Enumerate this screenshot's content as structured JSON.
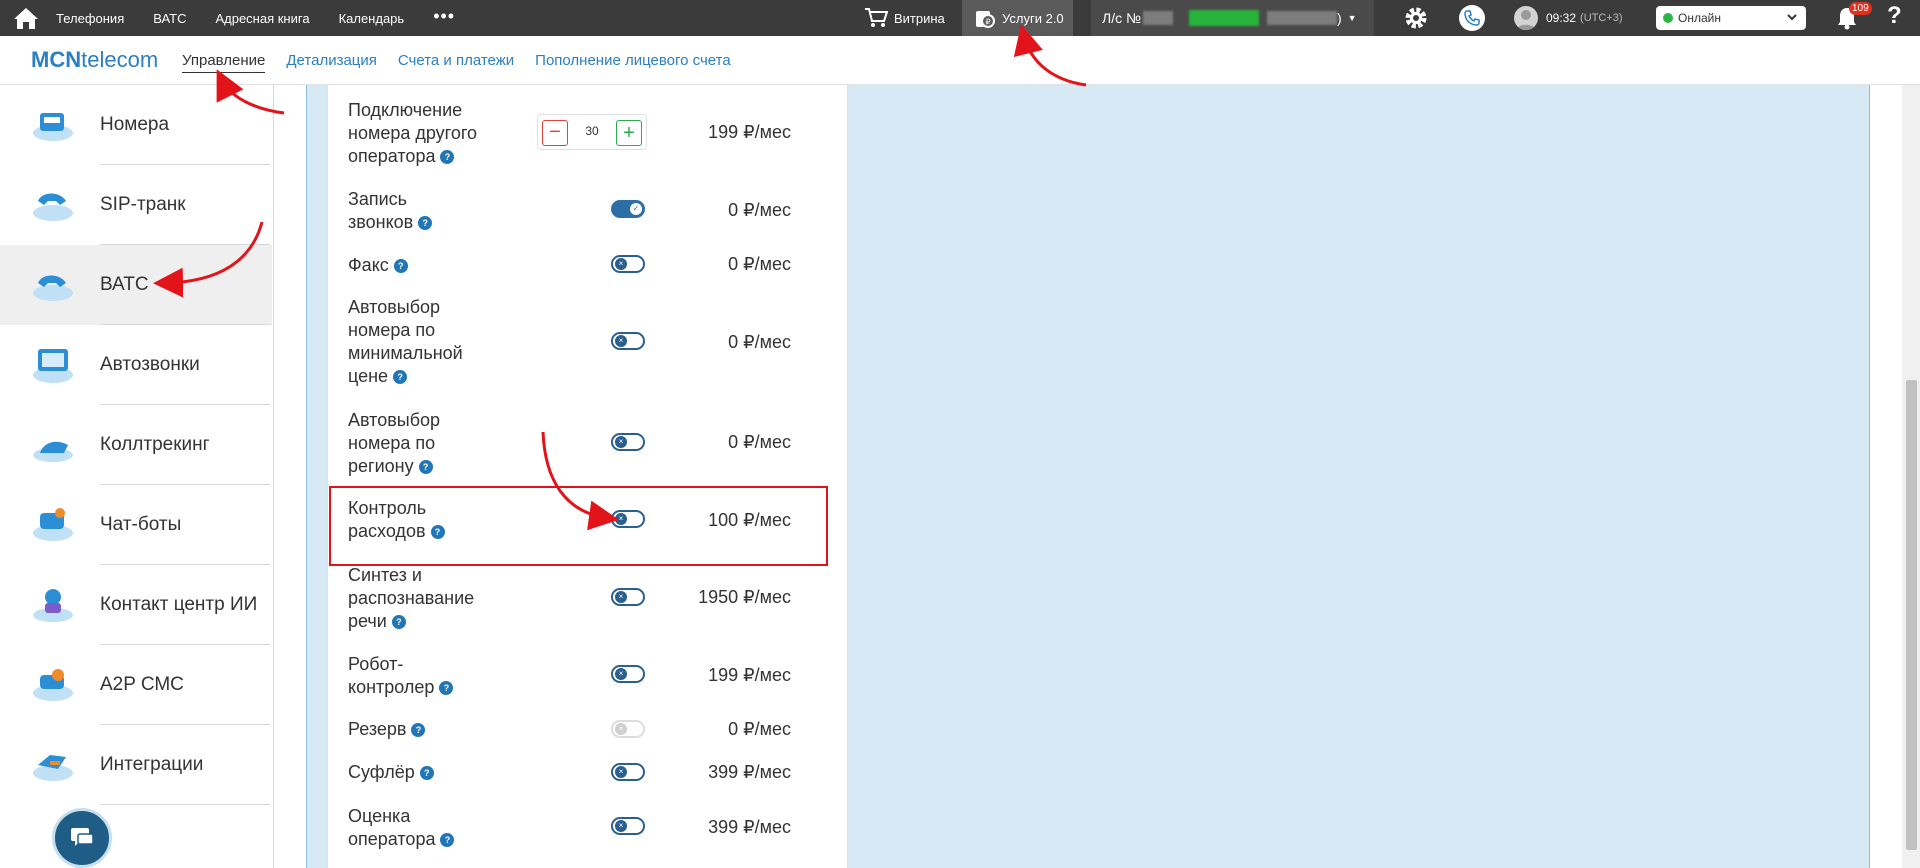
{
  "colors": {
    "accent": "#2b7fc2",
    "topbar": "#3b3b3b",
    "toggle": "#2b5f8d",
    "highlight": "#e3131a",
    "panel": "#d6e9f5"
  },
  "topbar": {
    "nav": [
      "Телефония",
      "ВАТС",
      "Адресная книга",
      "Календарь"
    ],
    "more": "•••",
    "vitrina": "Витрина",
    "uslugi": "Услуги 2.0",
    "account_prefix": "Л/с №",
    "account_suffix": ")",
    "time": "09:32",
    "timezone": "(UTC+3)",
    "status": "Онлайн",
    "notifications": "109",
    "help": "?"
  },
  "header": {
    "logo_bold": "MCN",
    "logo_rest": "telecom",
    "tabs": [
      "Управление",
      "Детализация",
      "Счета и платежи",
      "Пополнение лицевого счета"
    ]
  },
  "sidebar": {
    "items": [
      "Номера",
      "SIP-транк",
      "ВАТС",
      "Автозвонки",
      "Коллтрекинг",
      "Чат-боты",
      "Контакт центр ИИ",
      "A2P СМС",
      "Интеграции"
    ],
    "active": "ВАТС"
  },
  "services": [
    {
      "label": "Подключение номера другого оператора",
      "state": "stepper",
      "value": "30",
      "price": "199 ₽/мес"
    },
    {
      "label": "Запись звонков",
      "state": "on",
      "price": "0 ₽/мес"
    },
    {
      "label": "Факс",
      "state": "off",
      "price": "0 ₽/мес"
    },
    {
      "label": "Автовыбор номера по минимальной цене",
      "state": "off",
      "price": "0 ₽/мес"
    },
    {
      "label": "Автовыбор номера по региону",
      "state": "off",
      "price": "0 ₽/мес"
    },
    {
      "label": "Контроль расходов",
      "state": "off",
      "price": "100 ₽/мес",
      "highlighted": true
    },
    {
      "label": "Синтез и распознавание речи",
      "state": "off",
      "price": "1950 ₽/мес"
    },
    {
      "label": "Робот-контролер",
      "state": "off",
      "price": "199 ₽/мес"
    },
    {
      "label": "Резерв",
      "state": "disabled",
      "price": "0 ₽/мес"
    },
    {
      "label": "Суфлёр",
      "state": "off",
      "price": "399 ₽/мес"
    },
    {
      "label": "Оценка оператора",
      "state": "off",
      "price": "399 ₽/мес"
    }
  ],
  "stepper": {
    "minus": "−",
    "plus": "+"
  },
  "help_mark": "?",
  "toggle_glyphs": {
    "on": "✓",
    "off": "×"
  }
}
